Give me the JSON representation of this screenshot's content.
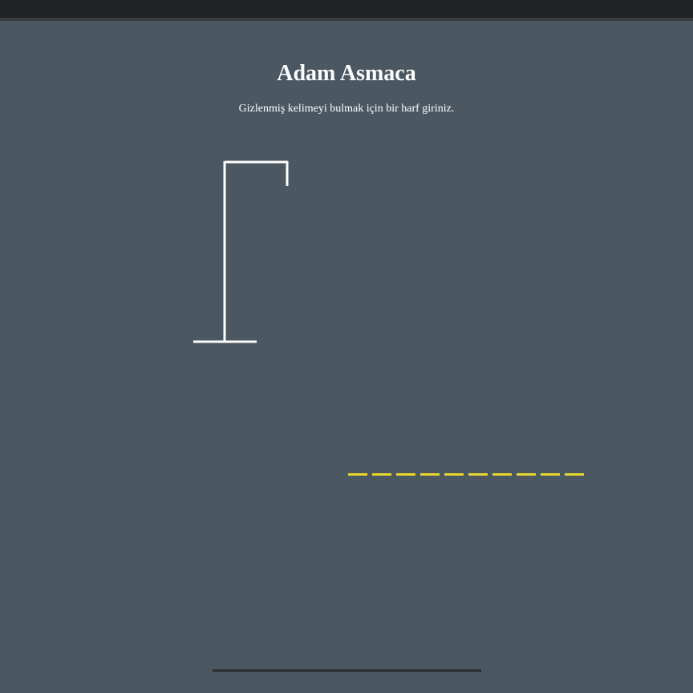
{
  "game": {
    "title": "Adam Asmaca",
    "instruction": "Gizlenmiş kelimeyi bulmak için bir harf giriniz.",
    "word_length": 10,
    "revealed_letters": [
      "",
      "",
      "",
      "",
      "",
      "",
      "",
      "",
      "",
      ""
    ],
    "wrong_guesses": 0
  },
  "colors": {
    "background": "#4b5862",
    "text": "#ffffff",
    "gallows": "#ffffff",
    "blank_slots": "#e6d62e"
  }
}
